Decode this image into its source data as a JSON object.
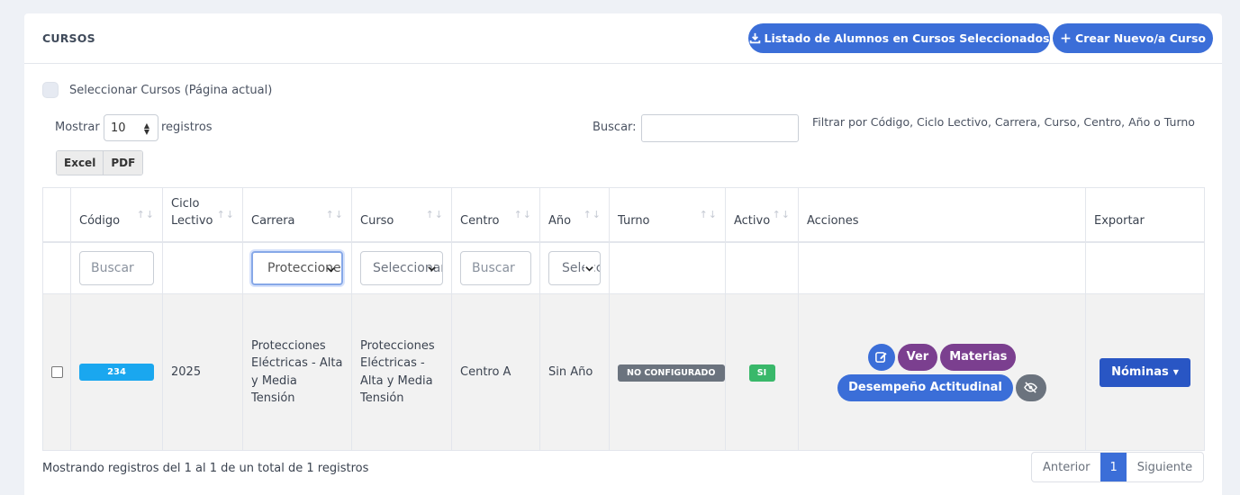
{
  "header": {
    "title": "CURSOS",
    "btn_list_label": "Listado de Alumnos en Cursos Seleccionados",
    "btn_new_label": "Crear Nuevo/a Curso",
    "accent": "#3b6ed8"
  },
  "select_all_label": "Seleccionar Cursos (Página actual)",
  "length": {
    "prefix": "Mostrar",
    "value": "10",
    "suffix": "registros"
  },
  "search": {
    "label": "Buscar:",
    "hint": "Filtrar por Código, Ciclo Lectivo, Carrera, Curso, Centro, Año o Turno"
  },
  "export_buttons": [
    "Excel",
    "PDF"
  ],
  "table": {
    "columns": [
      "Código",
      "Ciclo Lectivo",
      "Carrera",
      "Curso",
      "Centro",
      "Año",
      "Turno",
      "Activo",
      "Acciones",
      "Exportar"
    ],
    "filters": {
      "codigo_placeholder": "Buscar",
      "carrera_selected": "Protecciones",
      "curso_selected": "Seleccionar",
      "centro_placeholder": "Buscar",
      "anio_selected": "Seleccionar"
    },
    "rows": [
      {
        "codigo": "234",
        "ciclo": "2025",
        "carrera": "Protecciones Eléctricas - Alta y Media Tensión",
        "curso": "Protecciones Eléctricas - Alta y Media Tensión",
        "centro": "Centro A",
        "anio": "Sin Año",
        "turno": "NO CONFIGURADO",
        "activo": "SI",
        "actions": {
          "ver": "Ver",
          "materias": "Materias",
          "desempeno": "Desempeño Actitudinal"
        },
        "export_label": "Nóminas"
      }
    ]
  },
  "footer": {
    "info": "Mostrando registros del 1 al 1 de un total de 1 registros",
    "prev": "Anterior",
    "page": "1",
    "next": "Siguiente"
  },
  "colors": {
    "primary": "#3b6ed8",
    "purple": "#7b3f8f",
    "code_badge": "#1aa7ef",
    "success": "#39b86a",
    "secondary": "#6b737e",
    "dark_blue": "#2956c4"
  },
  "icons": [
    "download-icon",
    "plus-icon",
    "edit-icon",
    "eye-slash-icon",
    "caret-down-icon",
    "sort-icon"
  ]
}
